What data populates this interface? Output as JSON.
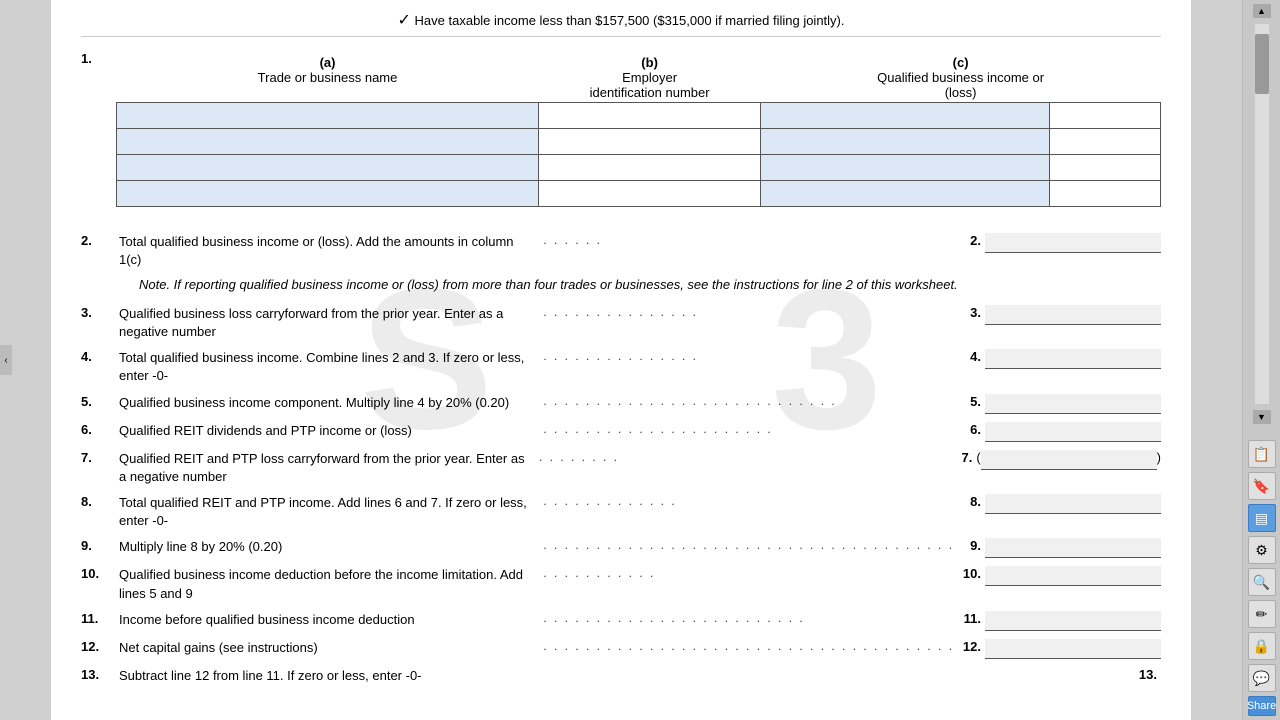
{
  "document": {
    "top_note": "Have taxable income less than $157,500 ($315,000 if married filing jointly).",
    "watermark": "S...3",
    "section1": {
      "line_number": "1.",
      "col_a_header": "(a)\nTrade or business name",
      "col_b_header": "(b)\nEmployer identification number",
      "col_c_header": "(c)\nQualified business income or (loss)",
      "rows": [
        {
          "a": "",
          "b": "",
          "c": "",
          "c2": ""
        },
        {
          "a": "",
          "b": "",
          "c": "",
          "c2": ""
        },
        {
          "a": "",
          "b": "",
          "c": "",
          "c2": ""
        },
        {
          "a": "",
          "b": "",
          "c": "",
          "c2": ""
        }
      ]
    },
    "lines": [
      {
        "num": "2.",
        "text": "Total qualified business income or (loss). Add the amounts in column 1(c)",
        "dots": " . . . . . .",
        "ref": "2.",
        "input_type": "normal",
        "input_value": ""
      },
      {
        "num": "",
        "text": "Note. If reporting qualified business income or (loss) from more than four trades or businesses, see the instructions for line 2 of this worksheet.",
        "is_note": true
      },
      {
        "num": "3.",
        "text": "Qualified business loss carryforward from the prior year. Enter as a negative number",
        "dots": " . . . . . . . . . . . . . . .",
        "ref": "3.",
        "input_type": "normal",
        "input_value": ""
      },
      {
        "num": "4.",
        "text": "Total qualified business income. Combine lines 2 and 3. If zero or less, enter -0-",
        "dots": " . . . . . . . . . . . . . . .",
        "ref": "4.",
        "input_type": "normal",
        "input_value": ""
      },
      {
        "num": "5.",
        "text": "Qualified business income component. Multiply line 4 by 20% (0.20)",
        "dots": " . . . . . . . . . . . . . . . . . . . . . . . . . . . .",
        "ref": "5.",
        "input_type": "normal",
        "input_value": ""
      },
      {
        "num": "6.",
        "text": "Qualified REIT dividends and PTP income or (loss)",
        "dots": " . . . . . . . . . . . . . . . . . . . . . .",
        "ref": "6.",
        "input_type": "normal",
        "input_value": ""
      },
      {
        "num": "7.",
        "text": "Qualified REIT and PTP loss carryforward from the prior year. Enter as a negative number",
        "dots": " . . . . . . . .",
        "ref": "7.",
        "input_type": "paren",
        "input_value": ""
      },
      {
        "num": "8.",
        "text": "Total qualified REIT and PTP income. Add lines 6 and 7. If zero or less, enter -0-",
        "dots": " . . . . . . . . . . . . .",
        "ref": "8.",
        "input_type": "normal",
        "input_value": ""
      },
      {
        "num": "9.",
        "text": "Multiply line 8 by 20% (0.20)",
        "dots": " . . . . . . . . . . . . . . . . . . . . . . . . . . . . . . . . . . . . . . . . . . . . . . .",
        "ref": "9.",
        "input_type": "normal",
        "input_value": ""
      },
      {
        "num": "10.",
        "text": "Qualified business income deduction before the income limitation. Add lines 5 and 9",
        "dots": " . . . . . . . . . . .",
        "ref": "10.",
        "input_type": "normal",
        "input_value": ""
      },
      {
        "num": "11.",
        "text": "Income before qualified business income deduction",
        "dots": " . . . . . . . . . . . . . . . . . . . . . . . . .",
        "ref": "11.",
        "input_type": "normal",
        "input_value": ""
      },
      {
        "num": "12.",
        "text": "Net capital gains (see instructions)",
        "dots": " . . . . . . . . . . . . . . . . . . . . . . . . . . . . . . . . . . . . . . . . . .",
        "ref": "12.",
        "input_type": "normal",
        "input_value": ""
      },
      {
        "num": "13.",
        "text": "Subtract line 12 from line 11. If zero or less, enter -0-",
        "dots": "",
        "ref": "13.",
        "input_type": "normal",
        "input_value": ""
      }
    ]
  },
  "sidebar": {
    "icons": [
      "📋",
      "🔖",
      "📊",
      "🔧",
      "🔍",
      "✏️",
      "🔒",
      "💬"
    ]
  }
}
